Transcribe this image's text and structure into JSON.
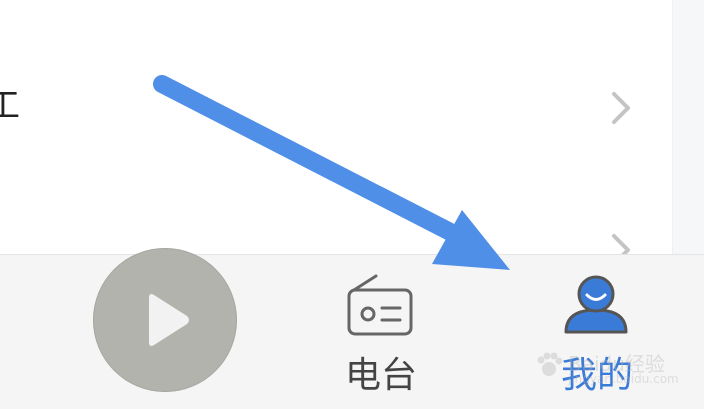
{
  "list": {
    "rows": [
      {
        "label": "工"
      },
      {
        "label": ""
      }
    ]
  },
  "player": {
    "play_icon": "play-icon"
  },
  "tabs": [
    {
      "label": "电台",
      "icon": "radio-icon",
      "active": false
    },
    {
      "label": "我的",
      "icon": "user-profile-icon",
      "active": true
    }
  ],
  "colors": {
    "accent": "#3b7bd8",
    "arrow": "#4f8fe8",
    "play_button": "#b3b3ae",
    "tab_bar": "#f5f5f5"
  },
  "watermark": {
    "text": "Baidu经验",
    "subtext": "jingyan.baidu.com"
  }
}
